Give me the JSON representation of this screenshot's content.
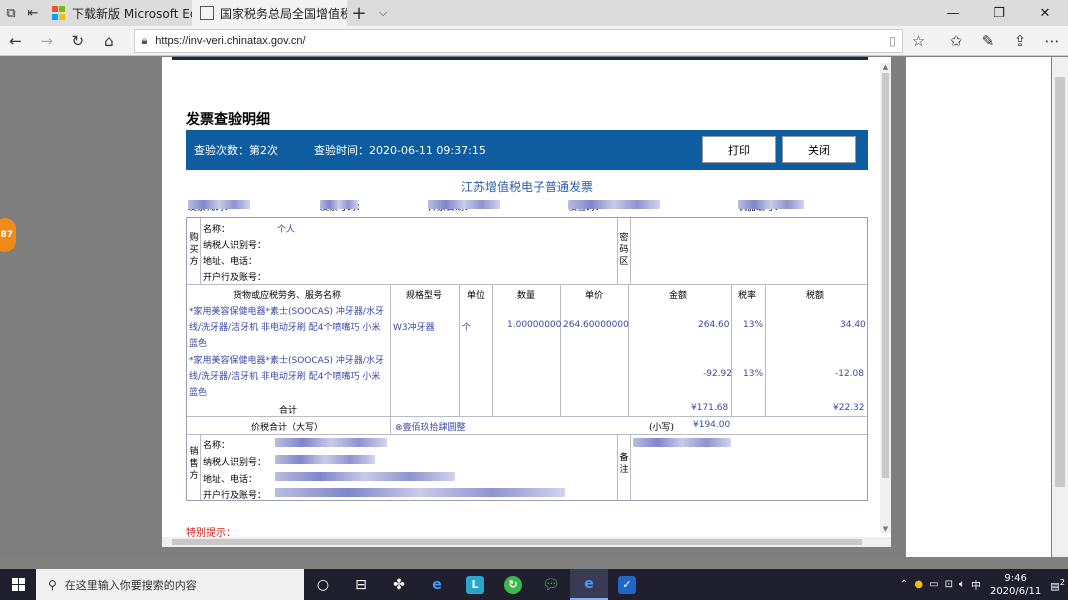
{
  "browser": {
    "tabs": [
      {
        "label": "下载新版 Microsoft Edge 浏"
      },
      {
        "label": "国家税务总局全国增值税"
      }
    ],
    "url": "https://inv-veri.chinatax.gov.cn/"
  },
  "side_badge": "87",
  "dialog": {
    "title": "发票查验明细",
    "check_count_label": "查验次数：第2次",
    "check_time_label": "查验时间：2020-06-11 09:37:15",
    "print_button": "打印",
    "close_button": "关闭",
    "invoice_title": "江苏增值税电子普通发票",
    "codes": {
      "invoice_code_label": "发票代码：",
      "invoice_no_label": "发票号码：",
      "date_label": "开票日期：",
      "check_code_label": "校验码：",
      "machine_label": "机器编号："
    },
    "buyer": {
      "side_label": "购买方",
      "name_label": "名称：",
      "name_value": "个人",
      "tax_id_label": "纳税人识别号：",
      "address_label": "地址、电话：",
      "bank_label": "开户行及账号："
    },
    "password_area_label": "密码区",
    "columns": {
      "goods": "货物或应税劳务、服务名称",
      "spec": "规格型号",
      "unit": "单位",
      "qty": "数量",
      "price": "单价",
      "amount": "金额",
      "rate": "税率",
      "tax": "税额"
    },
    "items": [
      {
        "name_line1": "*家用美容保健电器*素士(SOOCAS) 冲牙器/水牙",
        "name_line2": "线/洗牙器/洁牙机 非电动牙刷 配4个喷嘴巧 小米",
        "name_line3": "蓝色",
        "spec": "W3冲牙器",
        "unit": "个",
        "qty": "1.00000000",
        "price": "264.60000000",
        "amount": "264.60",
        "rate": "13%",
        "tax": "34.40"
      },
      {
        "name_line1": "*家用美容保健电器*素士(SOOCAS) 冲牙器/水牙",
        "name_line2": "线/洗牙器/洁牙机 非电动牙刷 配4个喷嘴巧 小米",
        "name_line3": "蓝色",
        "spec": "",
        "unit": "",
        "qty": "",
        "price": "",
        "amount": "-92.92",
        "rate": "13%",
        "tax": "-12.08"
      }
    ],
    "total_label": "合计",
    "total_amount": "¥171.68",
    "total_tax": "¥22.32",
    "price_tax_total_label": "价税合计（大写）",
    "price_tax_total_upper": "⊗壹佰玖拾肆圆整",
    "small_label": "(小写)",
    "small_value": "¥194.00",
    "seller": {
      "side_label": "销售方",
      "name_label": "名称：",
      "tax_id_label": "纳税人识别号：",
      "address_label": "地址、电话：",
      "bank_label": "开户行及账号："
    },
    "remarks_label": "备注",
    "special_note": "特别提示："
  },
  "taskbar": {
    "search_placeholder": "在这里输入你要搜索的内容",
    "ime": "中",
    "time": "9:46",
    "date": "2020/6/11",
    "notification_count": "2"
  },
  "colors": {
    "header_blue": "#0e5da0",
    "invoice_title_blue": "#2b5ea8",
    "special_note_red": "#cc2222"
  }
}
